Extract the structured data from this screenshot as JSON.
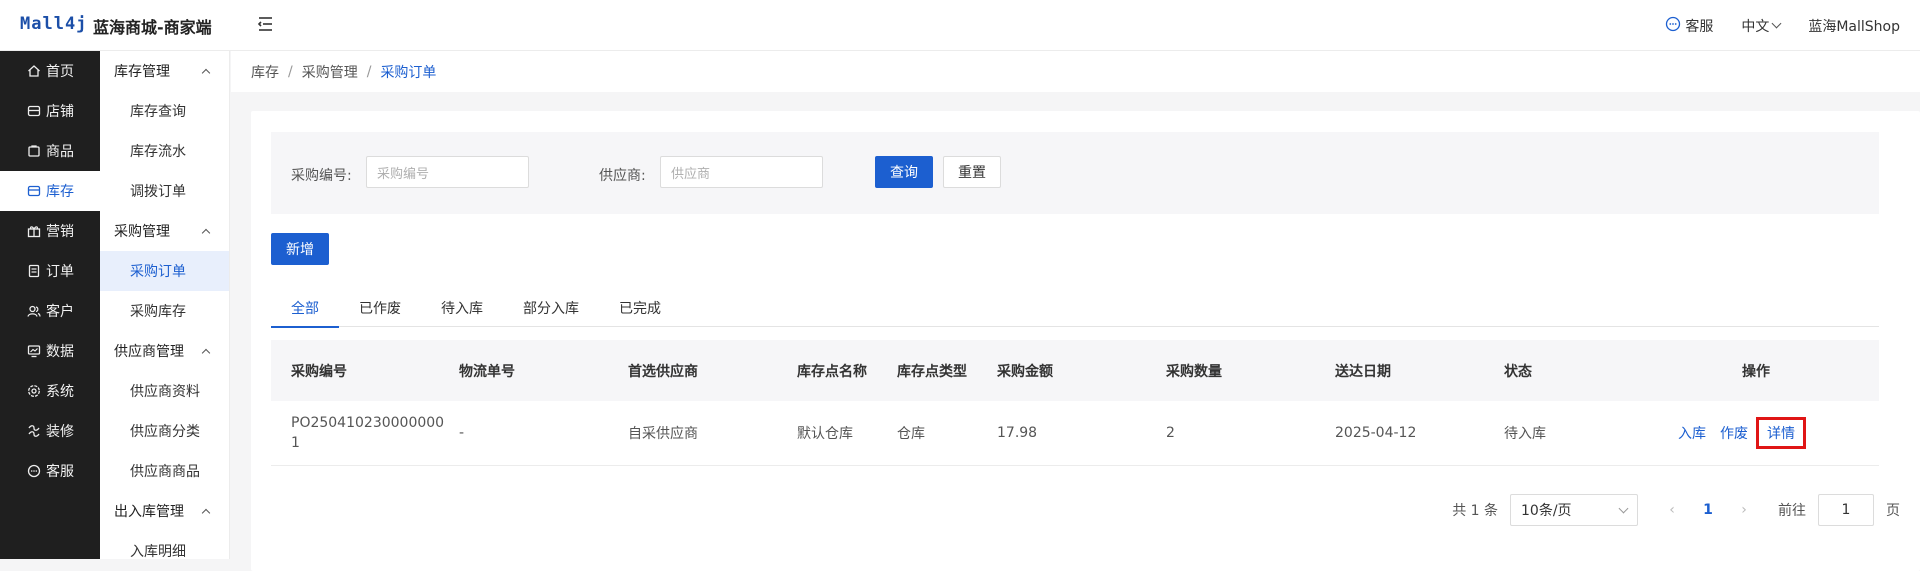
{
  "header": {
    "logo": "Mall4j",
    "brand": "蓝海商城-商家端",
    "service": "客服",
    "lang": "中文",
    "user": "蓝海MallShop"
  },
  "side1": [
    {
      "label": "首页",
      "icon": "home-icon"
    },
    {
      "label": "店铺",
      "icon": "shop-icon"
    },
    {
      "label": "商品",
      "icon": "goods-icon"
    },
    {
      "label": "库存",
      "icon": "inventory-icon",
      "active": true
    },
    {
      "label": "营销",
      "icon": "gift-icon"
    },
    {
      "label": "订单",
      "icon": "order-icon"
    },
    {
      "label": "客户",
      "icon": "customer-icon"
    },
    {
      "label": "数据",
      "icon": "data-icon"
    },
    {
      "label": "系统",
      "icon": "gear-icon"
    },
    {
      "label": "装修",
      "icon": "decorate-icon"
    },
    {
      "label": "客服",
      "icon": "chat-icon"
    }
  ],
  "side2": {
    "g1": "库存管理",
    "g1_items": [
      "库存查询",
      "库存流水",
      "调拨订单"
    ],
    "g2": "采购管理",
    "g2_items": [
      "采购订单",
      "采购库存"
    ],
    "g3": "供应商管理",
    "g3_items": [
      "供应商资料",
      "供应商分类",
      "供应商商品"
    ],
    "g4": "出入库管理",
    "g4_items": [
      "入库明细"
    ]
  },
  "breadcrumb": [
    "库存",
    "采购管理",
    "采购订单"
  ],
  "search": {
    "code_label": "采购编号:",
    "code_placeholder": "采购编号",
    "supplier_label": "供应商:",
    "supplier_placeholder": "供应商",
    "query": "查询",
    "reset": "重置"
  },
  "add_button": "新增",
  "tabs": [
    "全部",
    "已作废",
    "待入库",
    "部分入库",
    "已完成"
  ],
  "table": {
    "headers": [
      "采购编号",
      "物流单号",
      "首选供应商",
      "库存点名称",
      "库存点类型",
      "采购金额",
      "采购数量",
      "送达日期",
      "状态",
      "操作"
    ],
    "rows": [
      {
        "code_line1": "PO250410230000000",
        "code_line2": "1",
        "logistics": "-",
        "supplier": "自采供应商",
        "store_name": "默认仓库",
        "store_type": "仓库",
        "amount": "17.98",
        "qty": "2",
        "date": "2025-04-12",
        "status": "待入库",
        "op_in": "入库",
        "op_void": "作废",
        "op_detail": "详情"
      }
    ]
  },
  "pager": {
    "total": "共 1 条",
    "page_size": "10条/页",
    "current": "1",
    "goto": "前往",
    "goto_value": "1",
    "page_unit": "页"
  }
}
